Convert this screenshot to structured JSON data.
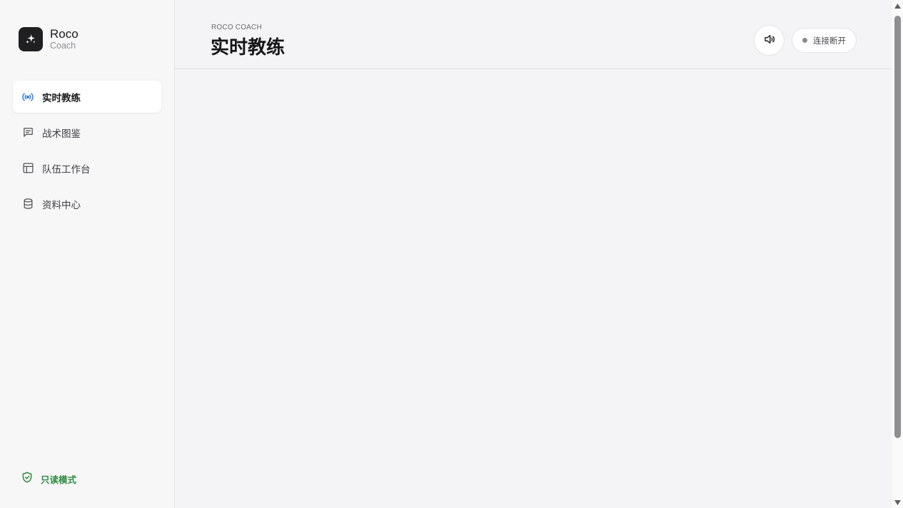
{
  "brand": {
    "name": "Roco",
    "subtitle": "Coach",
    "icon": "sparkles-icon"
  },
  "sidebar": {
    "items": [
      {
        "label": "实时教练",
        "icon": "broadcast-icon",
        "active": true
      },
      {
        "label": "战术图鉴",
        "icon": "message-square-icon",
        "active": false
      },
      {
        "label": "队伍工作台",
        "icon": "layout-icon",
        "active": false
      },
      {
        "label": "资料中心",
        "icon": "database-icon",
        "active": false
      }
    ],
    "footer": {
      "label": "只读模式",
      "icon": "shield-check-icon"
    }
  },
  "header": {
    "eyebrow": "ROCO COACH",
    "title": "实时教练",
    "sound_icon": "volume-icon",
    "status": {
      "label": "连接断开",
      "icon": "status-dot-icon"
    }
  },
  "colors": {
    "accent": "#2f7de1",
    "readonly_green": "#2e8b3f",
    "logo_bg": "#1f1f21",
    "status_dot": "#8a8a8f"
  }
}
